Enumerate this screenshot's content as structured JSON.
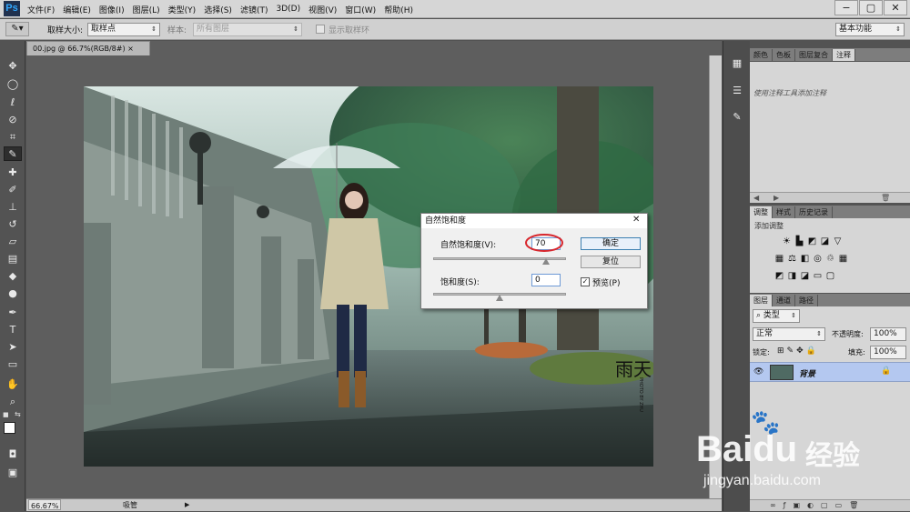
{
  "app": {
    "logo": "Ps"
  },
  "menu": [
    "文件(F)",
    "编辑(E)",
    "图像(I)",
    "图层(L)",
    "类型(Y)",
    "选择(S)",
    "滤镜(T)",
    "3D(D)",
    "视图(V)",
    "窗口(W)",
    "帮助(H)"
  ],
  "window_controls": {
    "minimize": "−",
    "maximize": "▢",
    "close": "✕"
  },
  "options": {
    "sample_size_label": "取样大小:",
    "sample_size_value": "取样点",
    "sample_label": "样本:",
    "sample_value": "所有图层",
    "show_ring_label": "显示取样环",
    "workspace": "基本功能"
  },
  "document": {
    "tab": "00.jpg @ 66.7%(RGB/8#)",
    "zoom": "66.67%",
    "status": "吸管"
  },
  "watermark": {
    "line1": "雨天",
    "side": "PHOTO BY ZHU"
  },
  "dialog": {
    "title": "自然饱和度",
    "close": "✕",
    "vibrance_label": "自然饱和度(V):",
    "vibrance_value": "70",
    "saturation_label": "饱和度(S):",
    "saturation_value": "0",
    "ok": "确定",
    "reset": "复位",
    "preview_label": "预览(P)",
    "vibrance_slider_fraction": 0.85,
    "saturation_slider_fraction": 0.5
  },
  "panels": {
    "top_tabs": [
      "颜色",
      "色板",
      "图层复合",
      "注释"
    ],
    "notes_text": "使用注释工具添加注释",
    "adjust_tabs": [
      "调整",
      "样式",
      "历史记录"
    ],
    "adjust_hint": "添加调整",
    "layer_tabs": [
      "图层",
      "通道",
      "路径"
    ],
    "filter_kind": "类型",
    "blend_mode": "正常",
    "opacity_label": "不透明度:",
    "opacity_value": "100%",
    "lock_label": "锁定:",
    "fill_label": "填充:",
    "fill_value": "100%",
    "layer_name": "背景"
  },
  "baidu": {
    "brand": "Baidu",
    "jingyan": "经验",
    "url": "jingyan.baidu.com"
  },
  "colors": {
    "accent": "#31a8ff",
    "circle": "#d8262c",
    "selected_layer": "#b4c8f0"
  }
}
